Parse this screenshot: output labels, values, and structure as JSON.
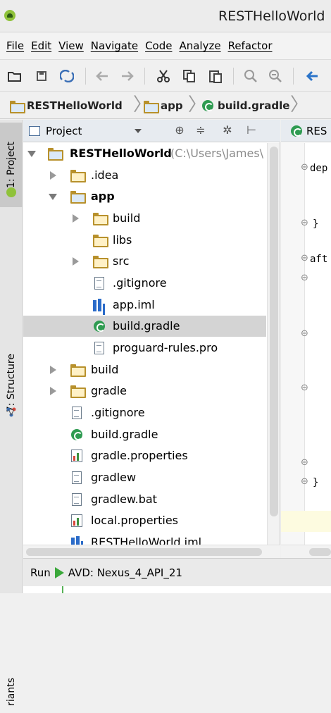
{
  "window": {
    "title": "RESTHelloWorld"
  },
  "menu": [
    "File",
    "Edit",
    "View",
    "Navigate",
    "Code",
    "Analyze",
    "Refactor"
  ],
  "toolbar_icons": [
    "open-folder-icon",
    "save-icon",
    "sync-icon",
    "undo-icon",
    "redo-icon",
    "cut-icon",
    "copy-icon",
    "paste-icon",
    "find-icon",
    "replace-icon",
    "back-icon"
  ],
  "breadcrumb": {
    "root": "RESTHelloWorld",
    "module": "app",
    "file": "build.gradle"
  },
  "side_tabs": {
    "project": "1: Project",
    "structure": "7: Structure",
    "variants": "riants"
  },
  "project_panel": {
    "view": "Project"
  },
  "tree": [
    {
      "label": "RESTHelloWorld",
      "path": "(C:\\Users\\James\\",
      "type": "module-folder",
      "expanded": true
    },
    {
      "label": ".idea",
      "type": "folder",
      "expanded": false
    },
    {
      "label": "app",
      "type": "module-folder",
      "expanded": true
    },
    {
      "label": "build",
      "type": "folder",
      "expanded": false
    },
    {
      "label": "libs",
      "type": "folder"
    },
    {
      "label": "src",
      "type": "folder",
      "expanded": false
    },
    {
      "label": ".gitignore",
      "type": "file"
    },
    {
      "label": "app.iml",
      "type": "iml"
    },
    {
      "label": "build.gradle",
      "type": "gradle",
      "selected": true
    },
    {
      "label": "proguard-rules.pro",
      "type": "file"
    },
    {
      "label": "build",
      "type": "folder",
      "expanded": false
    },
    {
      "label": "gradle",
      "type": "folder",
      "expanded": false
    },
    {
      "label": ".gitignore",
      "type": "file"
    },
    {
      "label": "build.gradle",
      "type": "gradle"
    },
    {
      "label": "gradle.properties",
      "type": "properties"
    },
    {
      "label": "gradlew",
      "type": "file"
    },
    {
      "label": "gradlew.bat",
      "type": "file"
    },
    {
      "label": "local.properties",
      "type": "properties"
    },
    {
      "label": "RESTHelloWorld.iml",
      "type": "iml"
    }
  ],
  "editor": {
    "tab": "RES",
    "lines": [
      "dep",
      "}",
      "aft",
      "}"
    ]
  },
  "run_bar": {
    "label": "Run",
    "config": "AVD: Nexus_4_API_21"
  },
  "colors": {
    "selection": "#d4d4d4",
    "gradle_green": "#2e9b51",
    "folder": "#b8912c",
    "run_green": "#3aa83a"
  }
}
